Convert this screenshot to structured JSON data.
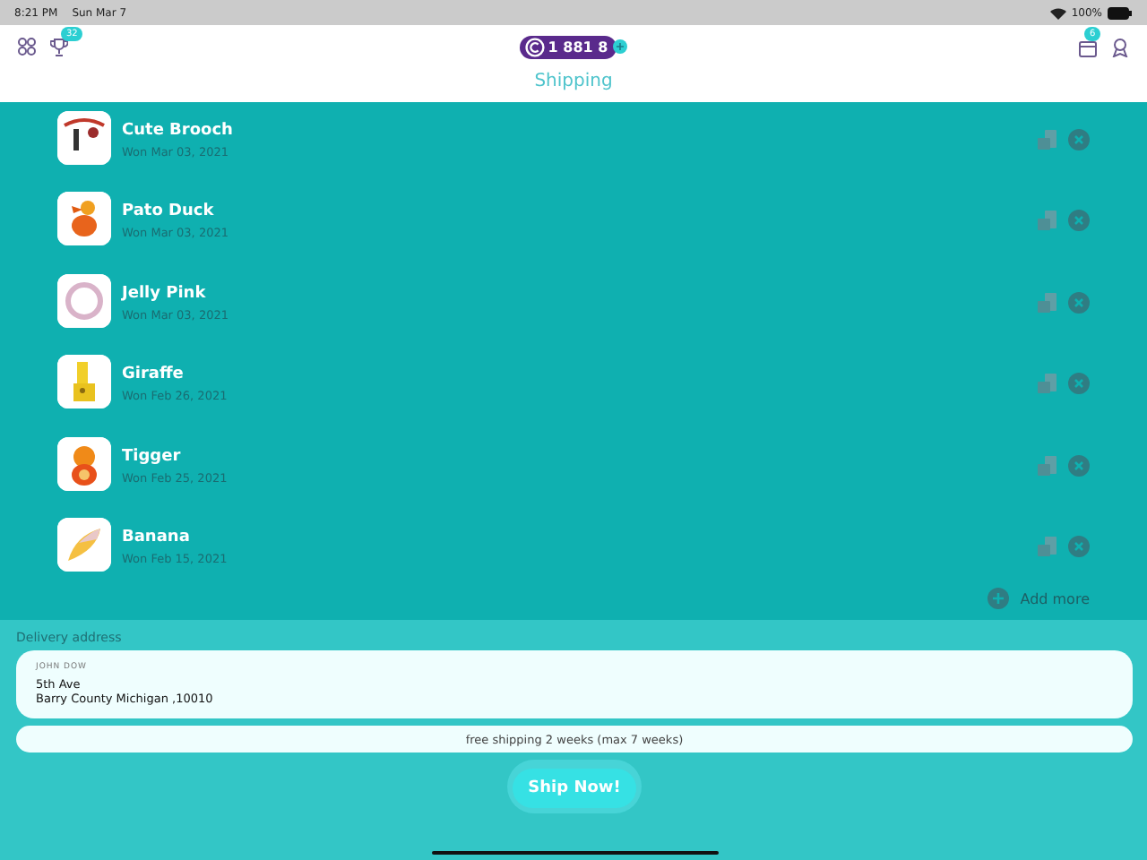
{
  "status_bar": {
    "time": "8:21 PM",
    "date": "Sun Mar 7",
    "battery": "100%"
  },
  "header": {
    "trophy_badge": "32",
    "coins": "1 881 8",
    "box_badge": "6",
    "title": "Shipping"
  },
  "items": [
    {
      "name": "Cute Brooch",
      "date": "Won Mar 03, 2021"
    },
    {
      "name": "Pato Duck",
      "date": "Won Mar 03, 2021"
    },
    {
      "name": "Jelly Pink",
      "date": "Won Mar 03, 2021"
    },
    {
      "name": "Giraffe",
      "date": "Won Feb 26, 2021"
    },
    {
      "name": "Tigger",
      "date": "Won Feb 25, 2021"
    },
    {
      "name": "Banana",
      "date": "Won Feb 15, 2021"
    }
  ],
  "add_more": "Add more",
  "delivery": {
    "label": "Delivery address",
    "name": "JOHN DOW",
    "line1": "5th Ave",
    "line2": "Barry County Michigan ,10010"
  },
  "shipping_note": "free shipping 2 weeks (max 7 weeks)",
  "button": "Ship Now!"
}
